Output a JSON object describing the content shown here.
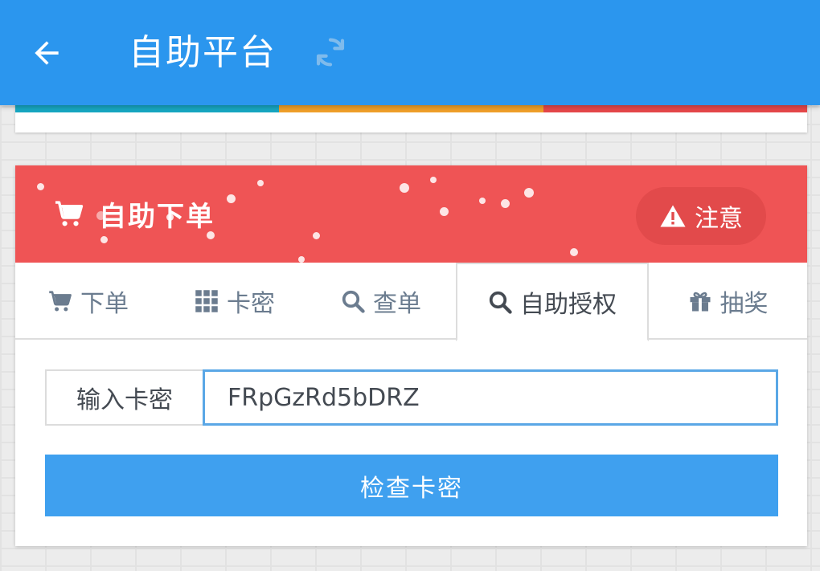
{
  "appbar": {
    "title": "自助平台",
    "back_icon": "arrow-left-icon",
    "refresh_icon": "refresh-icon"
  },
  "prev_card": {
    "stripe_colors": [
      "#17a7c2",
      "#f0a02a",
      "#e6484a"
    ]
  },
  "card": {
    "title": "自助下单",
    "title_icon": "cart-icon",
    "notice_label": "注意",
    "notice_icon": "warning-icon",
    "header_color": "#ef5455"
  },
  "tabs": [
    {
      "label": "下单",
      "icon": "cart-icon",
      "active": false
    },
    {
      "label": "卡密",
      "icon": "grid-icon",
      "active": false
    },
    {
      "label": "查单",
      "icon": "search-icon",
      "active": false
    },
    {
      "label": "自助授权",
      "icon": "search-icon",
      "active": true
    },
    {
      "label": "抽奖",
      "icon": "gift-icon",
      "active": false
    }
  ],
  "form": {
    "input_label": "输入卡密",
    "input_value": "FRpGzRd5bDRZ",
    "submit_label": "检查卡密"
  },
  "colors": {
    "appbar": "#2b96ee",
    "button": "#3fa0ef",
    "input_focus": "#5aa7e6"
  }
}
